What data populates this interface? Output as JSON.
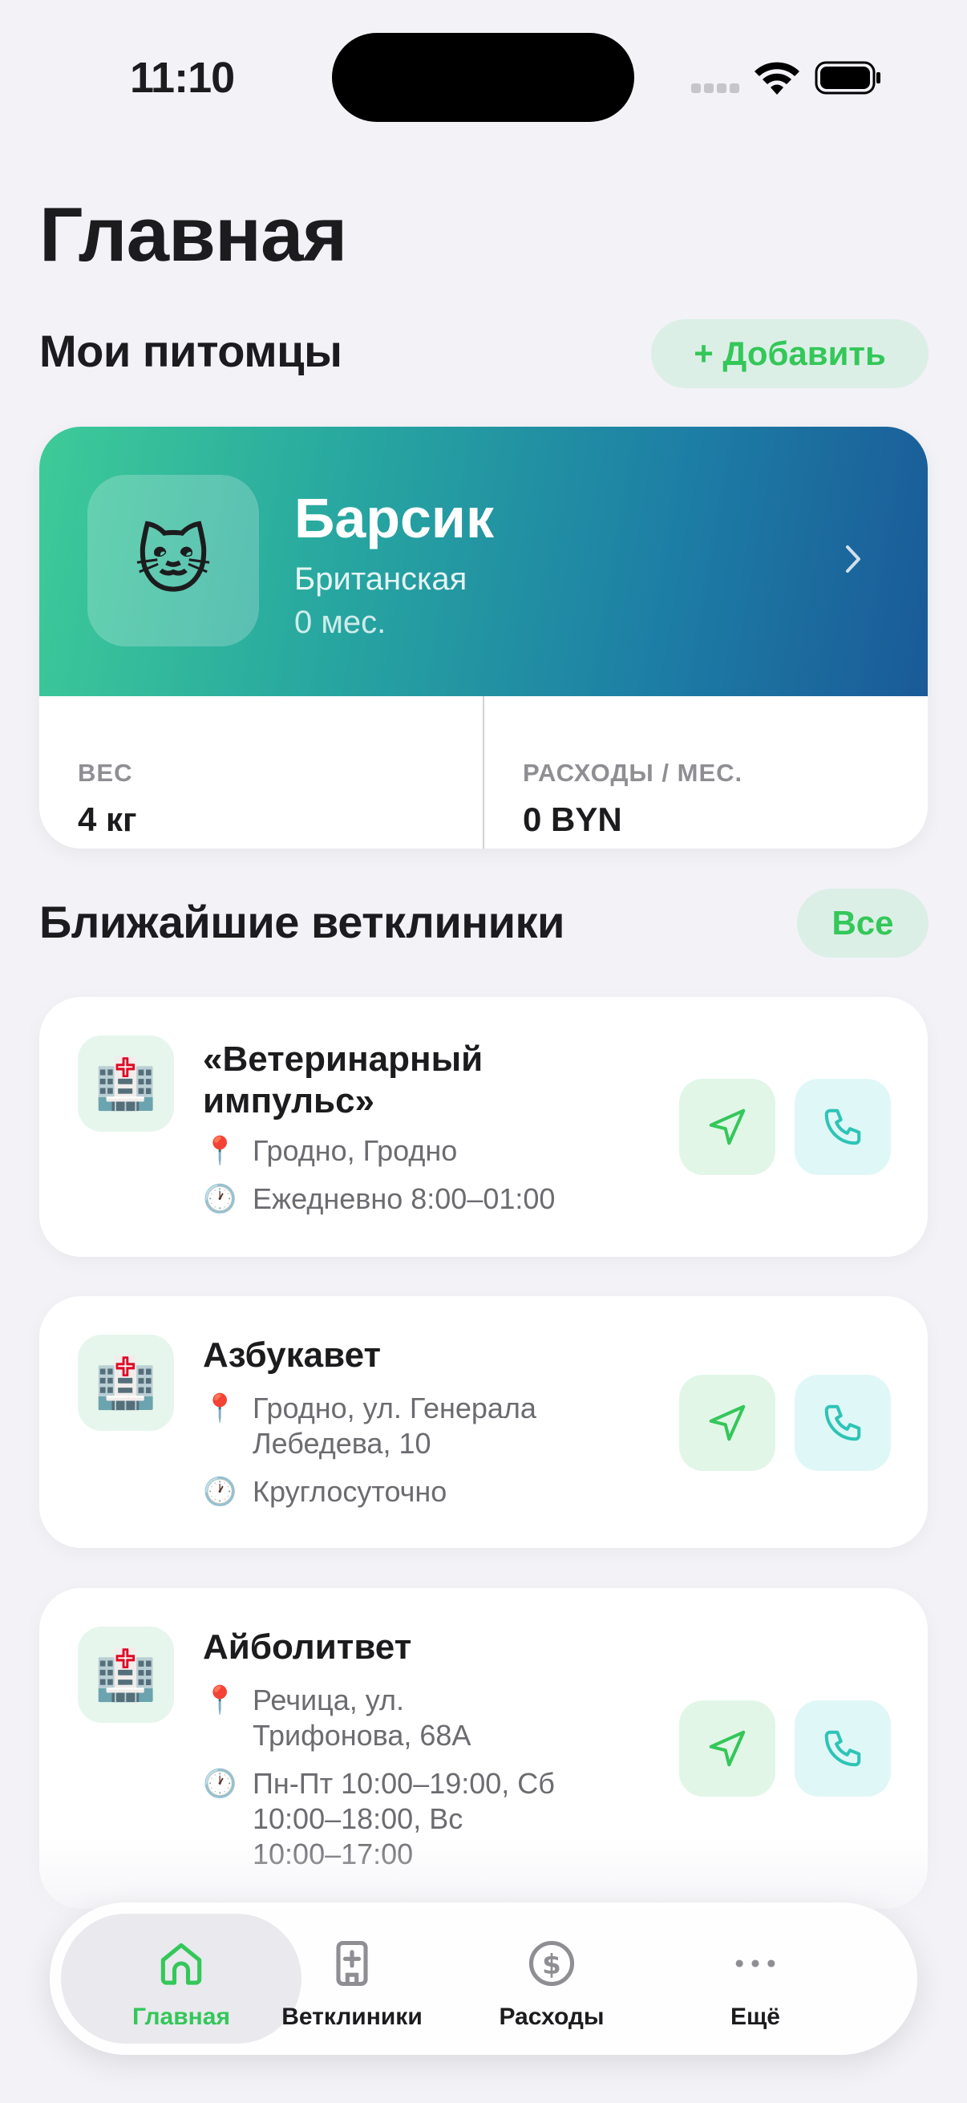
{
  "status_bar": {
    "time": "11:10"
  },
  "page": {
    "title": "Главная"
  },
  "pets": {
    "title": "Мои питомцы",
    "add_label": "+ Добавить",
    "pet": {
      "emoji": "🐱",
      "name": "Барсик",
      "breed": "Британская",
      "age": "0 мес.",
      "weight_label": "ВЕС",
      "weight_value": "4 кг",
      "expenses_label": "РАСХОДЫ / МЕС.",
      "expenses_value": "0 BYN"
    }
  },
  "clinics": {
    "title": "Ближайшие ветклиники",
    "all_label": "Все",
    "items": [
      {
        "icon": "🏥",
        "name": "«Ветеринарный импульс»",
        "address": "Гродно, Гродно",
        "hours": "Ежедневно 8:00–01:00"
      },
      {
        "icon": "🏥",
        "name": "Азбукавет",
        "address": "Гродно, ул. Генерала Лебедева, 10",
        "hours": "Круглосуточно"
      },
      {
        "icon": "🏥",
        "name": "Айболитвет",
        "address": "Речица, ул. Трифонова, 68А",
        "hours": "Пн-Пт 10:00–19:00, Сб 10:00–18:00, Вс 10:00–17:00"
      }
    ],
    "pin_icon": "📍",
    "clock_icon": "🕐"
  },
  "tabs": [
    {
      "label": "Главная",
      "icon": "house-icon",
      "active": true
    },
    {
      "label": "Ветклиники",
      "icon": "clinic-icon",
      "active": false
    },
    {
      "label": "Расходы",
      "icon": "dollar-circle-icon",
      "active": false
    },
    {
      "label": "Ещё",
      "icon": "ellipsis-icon",
      "active": false
    }
  ],
  "colors": {
    "accent": "#34c759",
    "background": "#f2f2f7",
    "banner_start": "#3ecb98",
    "banner_end": "#1a5a98"
  }
}
